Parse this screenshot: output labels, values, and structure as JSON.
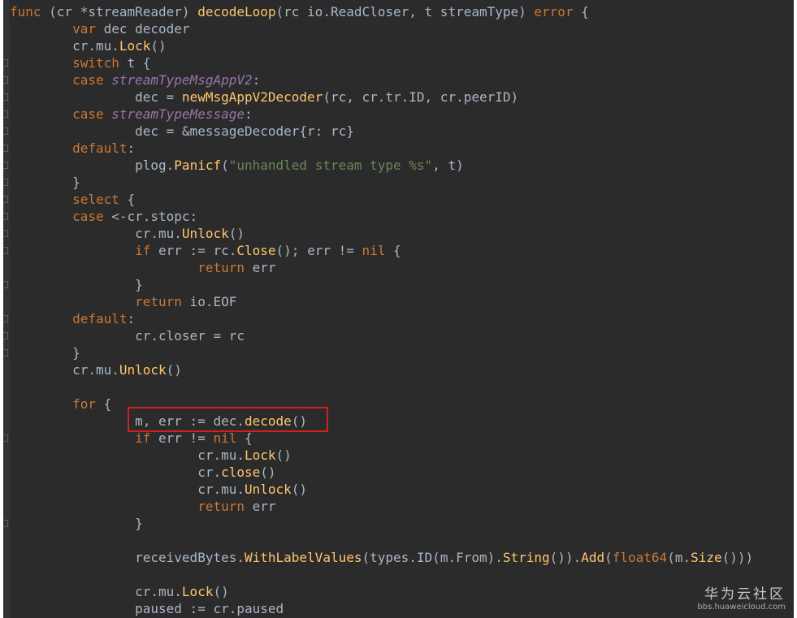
{
  "editor": {
    "theme": "dark",
    "colors": {
      "background": "#2b2b2b",
      "keyword": "#cc7832",
      "function": "#ffc66d",
      "type": "#9876aa",
      "string": "#6a8759",
      "plain": "#a9b7c6",
      "highlight_box": "#d02020"
    },
    "lines": [
      [
        {
          "t": "func",
          "c": "kw"
        },
        {
          "t": " (cr *streamReader) "
        },
        {
          "t": "decodeLoop",
          "c": "fn"
        },
        {
          "t": "(rc io.ReadCloser, t streamType) "
        },
        {
          "t": "error",
          "c": "kw"
        },
        {
          "t": " {"
        }
      ],
      [
        {
          "t": "        "
        },
        {
          "t": "var",
          "c": "kw"
        },
        {
          "t": " dec decoder"
        }
      ],
      [
        {
          "t": "        cr.mu."
        },
        {
          "t": "Lock",
          "c": "fn"
        },
        {
          "t": "()"
        }
      ],
      [
        {
          "t": "        "
        },
        {
          "t": "switch",
          "c": "kw"
        },
        {
          "t": " t {"
        }
      ],
      [
        {
          "t": "        "
        },
        {
          "t": "case",
          "c": "kw"
        },
        {
          "t": " "
        },
        {
          "t": "streamTypeMsgAppV2",
          "c": "ty"
        },
        {
          "t": ":"
        }
      ],
      [
        {
          "t": "                dec = "
        },
        {
          "t": "newMsgAppV2Decoder",
          "c": "fn"
        },
        {
          "t": "(rc, cr.tr.ID, cr.peerID)"
        }
      ],
      [
        {
          "t": "        "
        },
        {
          "t": "case",
          "c": "kw"
        },
        {
          "t": " "
        },
        {
          "t": "streamTypeMessage",
          "c": "ty"
        },
        {
          "t": ":"
        }
      ],
      [
        {
          "t": "                dec = &messageDecoder{r: rc}"
        }
      ],
      [
        {
          "t": "        "
        },
        {
          "t": "default",
          "c": "kw"
        },
        {
          "t": ":"
        }
      ],
      [
        {
          "t": "                plog."
        },
        {
          "t": "Panicf",
          "c": "fn"
        },
        {
          "t": "("
        },
        {
          "t": "\"unhandled stream type %s\"",
          "c": "str"
        },
        {
          "t": ", t)"
        }
      ],
      [
        {
          "t": "        }"
        }
      ],
      [
        {
          "t": "        "
        },
        {
          "t": "select",
          "c": "kw"
        },
        {
          "t": " {"
        }
      ],
      [
        {
          "t": "        "
        },
        {
          "t": "case",
          "c": "kw"
        },
        {
          "t": " <-cr.stopc:"
        }
      ],
      [
        {
          "t": "                cr.mu."
        },
        {
          "t": "Unlock",
          "c": "fn"
        },
        {
          "t": "()"
        }
      ],
      [
        {
          "t": "                "
        },
        {
          "t": "if",
          "c": "kw"
        },
        {
          "t": " err := rc."
        },
        {
          "t": "Close",
          "c": "fn"
        },
        {
          "t": "(); err != "
        },
        {
          "t": "nil",
          "c": "kw"
        },
        {
          "t": " {"
        }
      ],
      [
        {
          "t": "                        "
        },
        {
          "t": "return",
          "c": "kw"
        },
        {
          "t": " err"
        }
      ],
      [
        {
          "t": "                }"
        }
      ],
      [
        {
          "t": "                "
        },
        {
          "t": "return",
          "c": "kw"
        },
        {
          "t": " io.EOF"
        }
      ],
      [
        {
          "t": "        "
        },
        {
          "t": "default",
          "c": "kw"
        },
        {
          "t": ":"
        }
      ],
      [
        {
          "t": "                cr.closer = rc"
        }
      ],
      [
        {
          "t": "        }"
        }
      ],
      [
        {
          "t": "        cr.mu."
        },
        {
          "t": "Unlock",
          "c": "fn"
        },
        {
          "t": "()"
        }
      ],
      [
        {
          "t": ""
        }
      ],
      [
        {
          "t": "        "
        },
        {
          "t": "for",
          "c": "kw"
        },
        {
          "t": " {"
        }
      ],
      [
        {
          "t": "                m, err := dec."
        },
        {
          "t": "decode",
          "c": "fn"
        },
        {
          "t": "()"
        }
      ],
      [
        {
          "t": "                "
        },
        {
          "t": "if",
          "c": "kw"
        },
        {
          "t": " err != "
        },
        {
          "t": "nil",
          "c": "kw"
        },
        {
          "t": " {"
        }
      ],
      [
        {
          "t": "                        cr.mu."
        },
        {
          "t": "Lock",
          "c": "fn"
        },
        {
          "t": "()"
        }
      ],
      [
        {
          "t": "                        cr."
        },
        {
          "t": "close",
          "c": "fn"
        },
        {
          "t": "()"
        }
      ],
      [
        {
          "t": "                        cr.mu."
        },
        {
          "t": "Unlock",
          "c": "fn"
        },
        {
          "t": "()"
        }
      ],
      [
        {
          "t": "                        "
        },
        {
          "t": "return",
          "c": "kw"
        },
        {
          "t": " err"
        }
      ],
      [
        {
          "t": "                }"
        }
      ],
      [
        {
          "t": ""
        }
      ],
      [
        {
          "t": "                receivedBytes."
        },
        {
          "t": "WithLabelValues",
          "c": "fn"
        },
        {
          "t": "(types.ID(m.From)."
        },
        {
          "t": "String",
          "c": "fn"
        },
        {
          "t": "())."
        },
        {
          "t": "Add",
          "c": "fn"
        },
        {
          "t": "("
        },
        {
          "t": "float64",
          "c": "kw"
        },
        {
          "t": "(m."
        },
        {
          "t": "Size",
          "c": "fn"
        },
        {
          "t": "()))"
        }
      ],
      [
        {
          "t": ""
        }
      ],
      [
        {
          "t": "                cr.mu."
        },
        {
          "t": "Lock",
          "c": "fn"
        },
        {
          "t": "()"
        }
      ],
      [
        {
          "t": "                paused := cr.paused"
        }
      ]
    ]
  },
  "watermark": {
    "title": "华为云社区",
    "url": "bbs.huaweicloud.com"
  }
}
